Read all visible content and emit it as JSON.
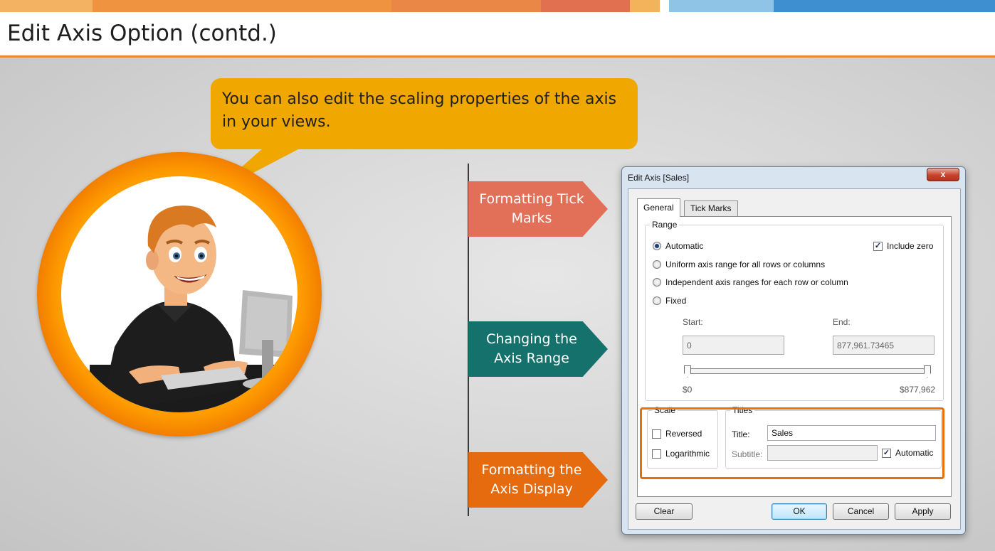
{
  "page": {
    "title": "Edit Axis Option (contd.)"
  },
  "colors": {
    "stripe": [
      "#f3b262",
      "#ef9340",
      "#eb8746",
      "#e0704f",
      "#f2b35b",
      "#ffffff",
      "#8fc4e6",
      "#3d8fd0"
    ],
    "bubble": "#f0a800",
    "arrow_tick_marks": "#e27059",
    "arrow_axis_range": "#15716b",
    "arrow_axis_display": "#e66b0e",
    "highlight": "#e56f0c"
  },
  "bubble": {
    "text": "You can also edit the scaling properties of the axis in your views."
  },
  "avatar": {
    "icon": "presenter-at-computer-illustration"
  },
  "arrows": [
    {
      "label": "Formatting Tick Marks"
    },
    {
      "label": "Changing the Axis Range"
    },
    {
      "label": "Formatting the Axis Display"
    }
  ],
  "dialog": {
    "title": "Edit Axis [Sales]",
    "close_label": "x",
    "tabs": [
      {
        "label": "General",
        "active": true
      },
      {
        "label": "Tick Marks",
        "active": false
      }
    ],
    "range": {
      "label": "Range",
      "options": [
        {
          "label": "Automatic",
          "selected": true
        },
        {
          "label": "Uniform axis range for all rows or columns",
          "selected": false
        },
        {
          "label": "Independent axis ranges for each row or column",
          "selected": false
        },
        {
          "label": "Fixed",
          "selected": false
        }
      ],
      "include_zero": {
        "label": "Include zero",
        "checked": true
      },
      "start_label": "Start:",
      "end_label": "End:",
      "start_value": "0",
      "end_value": "877,961.73465",
      "min_label": "$0",
      "max_label": "$877,962"
    },
    "scale": {
      "label": "Scale",
      "reversed": {
        "label": "Reversed",
        "checked": false
      },
      "logarithmic": {
        "label": "Logarithmic",
        "checked": false
      }
    },
    "titles": {
      "label": "Titles",
      "title_label": "Title:",
      "title_value": "Sales",
      "subtitle_label": "Subtitle:",
      "subtitle_value": "",
      "automatic": {
        "label": "Automatic",
        "checked": true
      }
    },
    "buttons": {
      "clear": "Clear",
      "ok": "OK",
      "cancel": "Cancel",
      "apply": "Apply"
    }
  }
}
